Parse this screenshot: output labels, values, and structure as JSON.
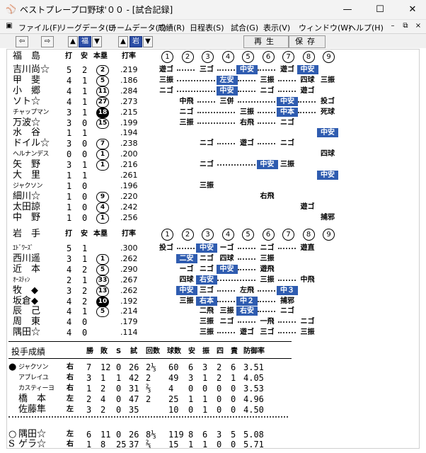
{
  "window": {
    "title": "ベストプレープロ野球'００ - [試合記録]",
    "minimize_icon": "minimize-icon",
    "maximize_icon": "maximize-icon",
    "close_icon": "close-icon"
  },
  "menu": [
    "ファイル(F)",
    "リーグデータ(L)",
    "チームデータ(T)",
    "成績(R)",
    "日程表(S)",
    "試合(G)",
    "表示(V)",
    "ウィンドウ(W)",
    "ヘルプ(H)"
  ],
  "toolbar": {
    "team1_label": "福",
    "team2_label": "岩",
    "play_label": "再生",
    "save_label": "保存"
  },
  "colors": {
    "hit_cell": "#2f5cb0"
  },
  "headers": {
    "at_bat": "打",
    "hits": "安",
    "homers": "本塁",
    "avg": "打率",
    "innings": [
      "1",
      "2",
      "3",
      "4",
      "5",
      "6",
      "7",
      "8",
      "9"
    ]
  },
  "teams": [
    {
      "name": "福　島",
      "players": [
        {
          "name": "吉川尚☆",
          "ab": "5",
          "h": "2",
          "hr": "2",
          "hr_filled": false,
          "avg": ".219",
          "cells": [
            "遊ゴ",
            "",
            "三ゴ",
            "",
            "中安",
            "",
            "遊ゴ",
            "中安",
            ""
          ],
          "cell_hits": [
            false,
            false,
            false,
            false,
            true,
            false,
            false,
            true,
            false
          ]
        },
        {
          "name": "甲　斐",
          "ab": "4",
          "h": "1",
          "hr": "5",
          "hr_filled": false,
          "avg": ".186",
          "cells": [
            "三振",
            "",
            "",
            "左安",
            "",
            "三振",
            "",
            "四球",
            "三振"
          ],
          "cell_hits": [
            false,
            false,
            false,
            true,
            false,
            false,
            false,
            false,
            false
          ]
        },
        {
          "name": "小　郷",
          "ab": "4",
          "h": "1",
          "hr": "11",
          "hr_filled": false,
          "avg": ".284",
          "cells": [
            "ニゴ",
            "",
            "",
            "中安",
            "",
            "ニゴ",
            "",
            "遊ゴ",
            ""
          ],
          "cell_hits": [
            false,
            false,
            false,
            true,
            false,
            false,
            false,
            false,
            false
          ]
        },
        {
          "name": "ソト☆",
          "ab": "4",
          "h": "1",
          "hr": "27",
          "hr_filled": false,
          "avg": ".273",
          "cells": [
            "",
            "中飛",
            "",
            "三併",
            "",
            "",
            "中安",
            "",
            "投ゴ"
          ],
          "cell_hits": [
            false,
            false,
            false,
            false,
            false,
            false,
            true,
            false,
            false
          ]
        },
        {
          "name": "チャップマン",
          "small": true,
          "ab": "3",
          "h": "1",
          "hr": "18",
          "hr_filled": true,
          "avg": ".215",
          "cells": [
            "",
            "ニゴ",
            "",
            "",
            "三振",
            "",
            "中本",
            "",
            "死球"
          ],
          "cell_hits": [
            false,
            false,
            false,
            false,
            false,
            false,
            true,
            false,
            false
          ]
        },
        {
          "name": "万波☆",
          "ab": "3",
          "h": "0",
          "hr": "15",
          "hr_filled": false,
          "avg": ".199",
          "cells": [
            "",
            "三振",
            "",
            "",
            "右飛",
            "",
            "ニゴ",
            "",
            ""
          ],
          "cell_hits": [
            false,
            false,
            false,
            false,
            false,
            false,
            false,
            false,
            false
          ]
        },
        {
          "name": "水　谷",
          "ab": "1",
          "h": "1",
          "hr": "",
          "hr_filled": false,
          "avg": ".194",
          "cells": [
            "",
            "",
            "",
            "",
            "",
            "",
            "",
            "",
            "中安"
          ],
          "cell_hits": [
            false,
            false,
            false,
            false,
            false,
            false,
            false,
            false,
            true
          ]
        },
        {
          "name": "ドイル☆",
          "ab": "3",
          "h": "0",
          "hr": "7",
          "hr_filled": false,
          "avg": ".238",
          "cells": [
            "",
            "",
            "ニゴ",
            "",
            "遊ゴ",
            "",
            "ニゴ",
            "",
            ""
          ],
          "cell_hits": [
            false,
            false,
            false,
            false,
            false,
            false,
            false,
            false,
            false
          ]
        },
        {
          "name": "ヘルナンデス",
          "small": true,
          "ab": "0",
          "h": "0",
          "hr": "1",
          "hr_filled": false,
          "avg": ".200",
          "cells": [
            "",
            "",
            "",
            "",
            "",
            "",
            "",
            "",
            "四球"
          ],
          "cell_hits": [
            false,
            false,
            false,
            false,
            false,
            false,
            false,
            false,
            false
          ]
        },
        {
          "name": "矢　野",
          "ab": "3",
          "h": "1",
          "hr": "1",
          "hr_filled": false,
          "avg": ".216",
          "cells": [
            "",
            "",
            "ニゴ",
            "",
            "",
            "中安",
            "三振",
            "",
            ""
          ],
          "cell_hits": [
            false,
            false,
            false,
            false,
            false,
            true,
            false,
            false,
            false
          ]
        },
        {
          "name": "大　里",
          "ab": "1",
          "h": "1",
          "hr": "",
          "hr_filled": false,
          "avg": ".261",
          "cells": [
            "",
            "",
            "",
            "",
            "",
            "",
            "",
            "",
            "中安"
          ],
          "cell_hits": [
            false,
            false,
            false,
            false,
            false,
            false,
            false,
            false,
            true
          ]
        },
        {
          "name": "ジャクソン",
          "small": true,
          "ab": "1",
          "h": "0",
          "hr": "",
          "hr_filled": false,
          "avg": ".196",
          "cells": [
            "",
            "",
            "三振",
            "",
            "",
            "",
            "",
            "",
            ""
          ],
          "cell_hits": [
            false,
            false,
            false,
            false,
            false,
            false,
            false,
            false,
            false
          ]
        },
        {
          "name": "細川☆",
          "ab": "1",
          "h": "0",
          "hr": "9",
          "hr_filled": false,
          "avg": ".220",
          "cells": [
            "",
            "",
            "",
            "",
            "",
            "右飛",
            "",
            "",
            ""
          ],
          "cell_hits": [
            false,
            false,
            false,
            false,
            false,
            false,
            false,
            false,
            false
          ]
        },
        {
          "name": "太田諒",
          "ab": "1",
          "h": "0",
          "hr": "4",
          "hr_filled": false,
          "avg": ".242",
          "cells": [
            "",
            "",
            "",
            "",
            "",
            "",
            "",
            "遊ゴ",
            ""
          ],
          "cell_hits": [
            false,
            false,
            false,
            false,
            false,
            false,
            false,
            false,
            false
          ]
        },
        {
          "name": "中　野",
          "ab": "1",
          "h": "0",
          "hr": "1",
          "hr_filled": false,
          "avg": ".256",
          "cells": [
            "",
            "",
            "",
            "",
            "",
            "",
            "",
            "",
            "捕邪"
          ],
          "cell_hits": [
            false,
            false,
            false,
            false,
            false,
            false,
            false,
            false,
            false
          ]
        }
      ]
    },
    {
      "name": "岩　手",
      "players": [
        {
          "name": "ｴﾄﾞﾜｰｽﾞ",
          "small": true,
          "ab": "5",
          "h": "1",
          "hr": "",
          "hr_filled": false,
          "avg": ".300",
          "cells": [
            "投ゴ",
            "",
            "中安",
            "ーゴ",
            "",
            "ニゴ",
            "",
            "遊直",
            ""
          ],
          "cell_hits": [
            false,
            false,
            true,
            false,
            false,
            false,
            false,
            false,
            false
          ]
        },
        {
          "name": "西川遥",
          "ab": "3",
          "h": "1",
          "hr": "1",
          "hr_filled": false,
          "avg": ".262",
          "cells": [
            "",
            "二安",
            "ニゴ",
            "四球",
            "",
            "三振",
            "",
            "",
            ""
          ],
          "cell_hits": [
            false,
            true,
            false,
            false,
            false,
            false,
            false,
            false,
            false
          ]
        },
        {
          "name": "近　本",
          "ab": "4",
          "h": "2",
          "hr": "5",
          "hr_filled": false,
          "avg": ".290",
          "cells": [
            "",
            "ーゴ",
            "ニゴ",
            "中安",
            "",
            "遊飛",
            "",
            "",
            ""
          ],
          "cell_hits": [
            false,
            false,
            false,
            true,
            false,
            false,
            false,
            false,
            false
          ]
        },
        {
          "name": "ｵｰｽﾃｨﾝ",
          "small": true,
          "ab": "2",
          "h": "1",
          "hr": "33",
          "hr_filled": false,
          "avg": ".267",
          "cells": [
            "",
            "四球",
            "右安",
            "",
            "",
            "三振",
            "",
            "中飛",
            ""
          ],
          "cell_hits": [
            false,
            false,
            true,
            false,
            false,
            false,
            false,
            false,
            false
          ]
        },
        {
          "name": "牧　◆",
          "ab": "3",
          "h": "2",
          "hr": "13",
          "hr_filled": false,
          "avg": ".262",
          "cells": [
            "",
            "中安",
            "三ゴ",
            "",
            "左飛",
            "",
            "中３",
            "",
            ""
          ],
          "cell_hits": [
            false,
            true,
            false,
            false,
            false,
            false,
            true,
            false,
            false
          ]
        },
        {
          "name": "坂倉◆",
          "ab": "4",
          "h": "2",
          "hr": "10",
          "hr_filled": true,
          "avg": ".192",
          "cells": [
            "",
            "三振",
            "右本",
            "",
            "中２",
            "",
            "捕邪",
            "",
            ""
          ],
          "cell_hits": [
            false,
            false,
            true,
            false,
            true,
            false,
            false,
            false,
            false
          ]
        },
        {
          "name": "辰　己",
          "ab": "4",
          "h": "1",
          "hr": "5",
          "hr_filled": false,
          "avg": ".214",
          "cells": [
            "",
            "",
            "二飛",
            "三振",
            "右安",
            "",
            "ニゴ",
            "",
            ""
          ],
          "cell_hits": [
            false,
            false,
            false,
            false,
            true,
            false,
            false,
            false,
            false
          ]
        },
        {
          "name": "周　東",
          "ab": "4",
          "h": "0",
          "hr": "",
          "hr_filled": false,
          "avg": ".179",
          "cells": [
            "",
            "",
            "三振",
            "ニゴ",
            "",
            "一飛",
            "",
            "ニゴ",
            ""
          ],
          "cell_hits": [
            false,
            false,
            false,
            false,
            false,
            false,
            false,
            false,
            false
          ]
        },
        {
          "name": "隅田☆",
          "ab": "4",
          "h": "0",
          "hr": "",
          "hr_filled": false,
          "avg": ".114",
          "cells": [
            "",
            "",
            "三振",
            "",
            "遊ゴ",
            "三ゴ",
            "",
            "三振",
            ""
          ],
          "cell_hits": [
            false,
            false,
            false,
            false,
            false,
            false,
            false,
            false,
            false
          ]
        }
      ]
    }
  ],
  "pitching": {
    "title": "投手成績",
    "headers": [
      "勝",
      "敗",
      "S",
      "試",
      "回数",
      "球数",
      "安",
      "振",
      "四",
      "責",
      "防御率"
    ],
    "pitchers": [
      {
        "mark": "●",
        "name": "ジャクソン",
        "small": true,
        "hand": "右",
        "w": "7",
        "l": "12",
        "s": "0",
        "g": "26",
        "ip": "2⅓",
        "np": "60",
        "h": "6",
        "so": "3",
        "bb": "2",
        "er": "6",
        "era": "3.51"
      },
      {
        "mark": "",
        "name": "アブレイユ",
        "small": true,
        "hand": "右",
        "w": "3",
        "l": "1",
        "s": "1",
        "g": "42",
        "ip": "2",
        "np": "49",
        "h": "3",
        "so": "1",
        "bb": "2",
        "er": "1",
        "era": "4.05"
      },
      {
        "mark": "",
        "name": "カスティーヨ",
        "small": true,
        "hand": "右",
        "w": "1",
        "l": "2",
        "s": "0",
        "g": "31",
        "ip": "⅔",
        "np": "4",
        "h": "0",
        "so": "0",
        "bb": "0",
        "er": "0",
        "era": "3.53"
      },
      {
        "mark": "",
        "name": "橋　本",
        "hand": "左",
        "w": "2",
        "l": "4",
        "s": "0",
        "g": "47",
        "ip": "2",
        "np": "25",
        "h": "1",
        "so": "1",
        "bb": "0",
        "er": "0",
        "era": "4.96"
      },
      {
        "mark": "",
        "name": "佐藤隼",
        "hand": "左",
        "w": "3",
        "l": "2",
        "s": "0",
        "g": "35",
        "ip": "",
        "np": "10",
        "h": "0",
        "so": "1",
        "bb": "0",
        "er": "0",
        "era": "4.50"
      },
      {
        "mark": "○",
        "name": "隅田☆",
        "hand": "左",
        "w": "6",
        "l": "11",
        "s": "0",
        "g": "26",
        "ip": "8⅓",
        "np": "119",
        "h": "8",
        "so": "6",
        "bb": "3",
        "er": "5",
        "era": "5.08"
      },
      {
        "mark": "S",
        "name": "ゲラ☆",
        "hand": "右",
        "w": "1",
        "l": "8",
        "s": "25",
        "g": "37",
        "ip": "⅔",
        "np": "15",
        "h": "1",
        "so": "1",
        "bb": "0",
        "er": "0",
        "era": "5.71"
      }
    ]
  }
}
